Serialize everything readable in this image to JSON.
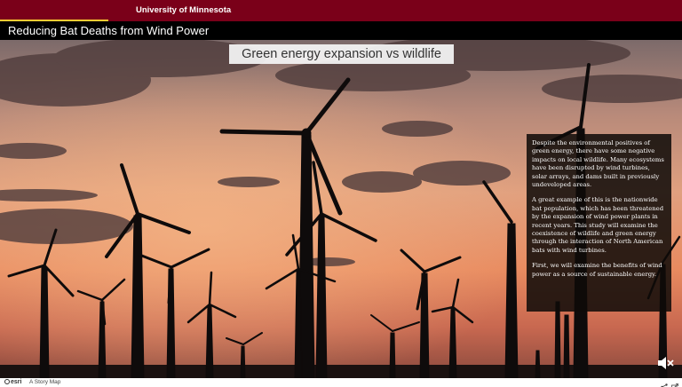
{
  "header": {
    "university": "University of Minnesota",
    "story_title": "Reducing Bat Deaths from Wind Power"
  },
  "section": {
    "title": "Green energy expansion vs wildlife"
  },
  "narrative": {
    "paragraphs": [
      "Despite the environmental positives of green energy, there have some negative impacts on local wildlife. Many ecosystems have been disrupted by wind turbines, solar arrays, and dams built in previously undeveloped areas.",
      "A great example of this is the nationwide bat population, which has been threatened by the expansion of wind power plants in recent years. This study will examine the coexistence of wildlife and green energy through the interaction of North American bats with wind turbines.",
      "First, we will examine the benefits of wind power as a source of sustainable energy."
    ]
  },
  "footer": {
    "logo_text": "esri",
    "story_map_label": "A Story Map"
  },
  "icons": {
    "mute": "speaker-muted-icon",
    "share": "share-icon",
    "fullscreen": "fullscreen-icon"
  },
  "colors": {
    "brand_maroon": "#7a0019",
    "brand_gold": "#ffcc33"
  }
}
